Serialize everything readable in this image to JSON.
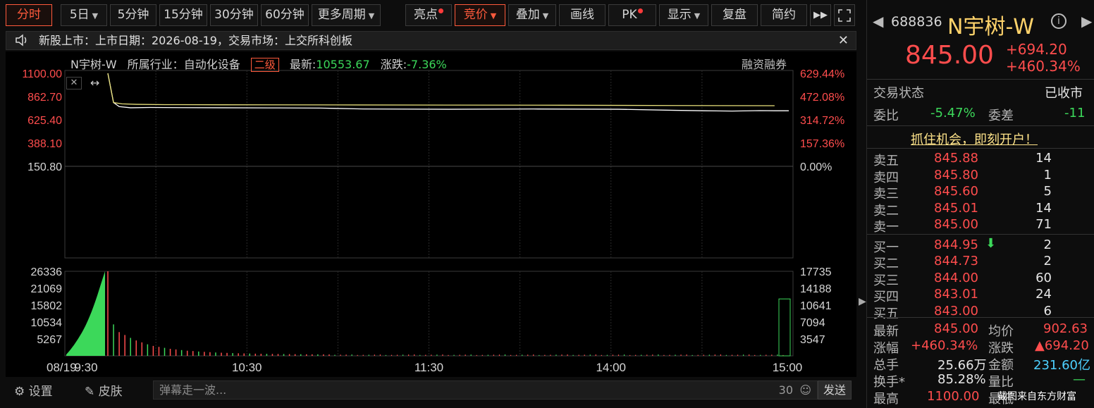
{
  "toolbar": {
    "tabs": [
      "分时",
      "5日",
      "5分钟",
      "15分钟",
      "30分钟",
      "60分钟",
      "更多周期"
    ],
    "tools": [
      "亮点",
      "竞价",
      "叠加",
      "画线",
      "PK",
      "显示",
      "复盘",
      "简约"
    ]
  },
  "notice": {
    "text": "新股上市：上市日期：2026-08-19，交易市场：上交所科创板"
  },
  "chart_info": {
    "stock_name": "N宇树-W",
    "industry_label": "所属行业：",
    "industry": "自动化设备",
    "level_tag": "二级",
    "latest_label": "最新:",
    "latest": "10553.67",
    "change_label": "涨跌:",
    "change": "-7.36%",
    "margin": "融资融券"
  },
  "chart_data": {
    "type": "line",
    "date_label": "08/19",
    "x_ticks": [
      "9:30",
      "10:30",
      "11:30",
      "14:00",
      "15:00"
    ],
    "price_ticks": [
      "1100.00",
      "862.70",
      "625.40",
      "388.10",
      "150.80"
    ],
    "pct_ticks": [
      "629.44%",
      "472.08%",
      "314.72%",
      "157.36%",
      "0.00%"
    ],
    "price_range": [
      150.8,
      1100.0
    ],
    "volume_ticks_left": [
      "26336",
      "21069",
      "15802",
      "10534",
      "5267"
    ],
    "volume_ticks_right": [
      "17735",
      "14188",
      "10641",
      "7094",
      "3547"
    ],
    "volume_range": [
      0,
      26336
    ],
    "series": [
      {
        "color": "#ffffff",
        "x": [
          0,
          2,
          4,
          8,
          15,
          25,
          40,
          60,
          75,
          80,
          90,
          120,
          150,
          180,
          200,
          210,
          220,
          230,
          235,
          240
        ],
        "values": [
          1100,
          905,
          878,
          870,
          872,
          871,
          870,
          869,
          868,
          866,
          862,
          860,
          862,
          860,
          853,
          850,
          848,
          851,
          850,
          850
        ]
      },
      {
        "color": "#e8e07a",
        "x": [
          0,
          2,
          5,
          10,
          20,
          40,
          80,
          120,
          160,
          200,
          235
        ],
        "values": [
          1100,
          905,
          896,
          893,
          891,
          890,
          889,
          888,
          887,
          885,
          884
        ]
      }
    ],
    "call_auction_volume": [
      420,
      1100,
      1800,
      2600,
      3400,
      4300,
      5200,
      6200,
      7200,
      8300,
      9500,
      10800,
      12200,
      13700,
      15300,
      17000,
      18800,
      20700,
      22600,
      24500,
      26336
    ],
    "volume_minutes": [
      26336,
      9800,
      7400,
      6500,
      5600,
      4800,
      4200,
      3600,
      3100,
      2800,
      2500,
      2200,
      2000,
      1800,
      1600,
      1500,
      1350,
      1250,
      1150,
      1050,
      980,
      920,
      860,
      800,
      760,
      720,
      680,
      650,
      620,
      600,
      580,
      560,
      540,
      520,
      500,
      480,
      470,
      460,
      450,
      440
    ]
  },
  "bottom_bar": {
    "settings": "设置",
    "skin": "皮肤",
    "danmu_placeholder": "弹幕走一波...",
    "danmu_count": "30",
    "send": "发送"
  },
  "quote": {
    "code": "688836",
    "name": "N宇树-W",
    "price": "845.00",
    "change": "+694.20",
    "change_pct": "+460.34%",
    "status_label": "交易状态",
    "status": "已收市",
    "weibi_label": "委比",
    "weibi": "-5.47%",
    "weicha_label": "委差",
    "weicha": "-11",
    "promo": "抓住机会，即刻开户！"
  },
  "orderbook": {
    "asks": [
      {
        "label": "卖五",
        "price": "845.88",
        "vol": "14"
      },
      {
        "label": "卖四",
        "price": "845.80",
        "vol": "1"
      },
      {
        "label": "卖三",
        "price": "845.60",
        "vol": "5"
      },
      {
        "label": "卖二",
        "price": "845.01",
        "vol": "14"
      },
      {
        "label": "卖一",
        "price": "845.00",
        "vol": "71"
      }
    ],
    "bids": [
      {
        "label": "买一",
        "price": "844.95",
        "vol": "2"
      },
      {
        "label": "买二",
        "price": "844.73",
        "vol": "2"
      },
      {
        "label": "买三",
        "price": "844.00",
        "vol": "60"
      },
      {
        "label": "买四",
        "price": "843.01",
        "vol": "24"
      },
      {
        "label": "买五",
        "price": "843.00",
        "vol": "6"
      }
    ]
  },
  "stats": {
    "latest_label": "最新",
    "latest": "845.00",
    "avg_label": "均价",
    "avg": "902.63",
    "chg_pct_label": "涨幅",
    "chg_pct": "+460.34%",
    "chg_label": "涨跌",
    "chg": "▲694.20",
    "hands_label": "总手",
    "hands": "25.66万",
    "amount_label": "金额",
    "amount": "231.60亿",
    "turnover_label": "换手*",
    "turnover": "85.28%",
    "vr_label": "量比",
    "vr": "—",
    "high_label": "最高",
    "high": "1100.00",
    "low_label": "最低"
  },
  "watermark": "截图来自东方财富",
  "colors": {
    "up": "#ff4d4d",
    "down": "#3cd85a",
    "price_line": "#ffffff",
    "avg_line": "#e8e07a",
    "accent": "#ff5a3c"
  }
}
